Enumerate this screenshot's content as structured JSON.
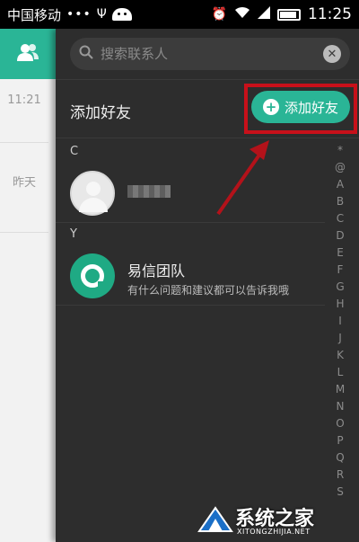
{
  "status_bar": {
    "carrier": "中国移动",
    "dots": "•••",
    "time": "11:25"
  },
  "left_strip": {
    "time_1": "11:21",
    "time_2": "昨天"
  },
  "search": {
    "placeholder": "搜索联系人"
  },
  "add_bar": {
    "title": "添加好友",
    "button_label": "添加好友"
  },
  "sections": [
    {
      "letter": "C",
      "contacts": [
        {
          "name": ""
        }
      ]
    },
    {
      "letter": "Y",
      "contacts": [
        {
          "name": "易信团队",
          "subtitle": "有什么问题和建议都可以告诉我哦"
        }
      ]
    }
  ],
  "index_letters": [
    "*",
    "@",
    "A",
    "B",
    "C",
    "D",
    "E",
    "F",
    "G",
    "H",
    "I",
    "J",
    "K",
    "L",
    "M",
    "N",
    "O",
    "P",
    "Q",
    "R",
    "S"
  ],
  "watermark": {
    "text": "系统之家",
    "sub": "XITONGZHIJIA.NET"
  },
  "colors": {
    "accent": "#2ab596",
    "highlight": "#c8101a",
    "panel_bg": "#2d2d2d"
  },
  "icons": [
    "contacts-icon",
    "search-icon",
    "clear-icon",
    "plus-icon",
    "default-avatar-icon",
    "yixin-logo-icon"
  ]
}
